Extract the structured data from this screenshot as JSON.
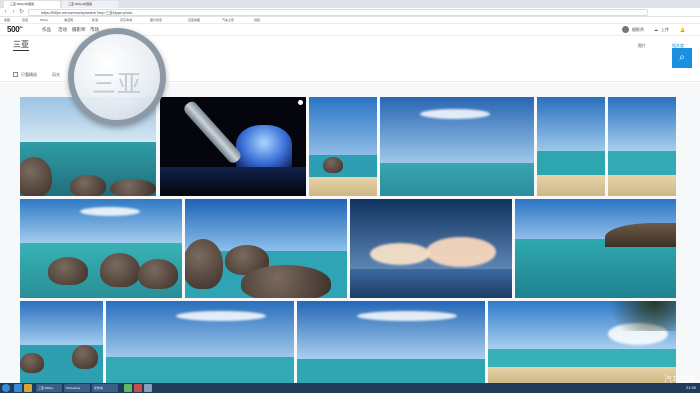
{
  "browser": {
    "tabs": [
      {
        "label": "三亚-500px中国版"
      },
      {
        "label": "三亚-500px中国版"
      }
    ],
    "url": "https://500px.me/community/search?key=三亚&type=photo"
  },
  "bookmarks": [
    "收藏",
    "百度",
    "500px",
    "淘宝网",
    "新浪",
    "京东商城",
    "图片搜索",
    "百度地图",
    "汽车之家",
    "视频"
  ],
  "site": {
    "logo": "500",
    "logo_sup": "px",
    "nav": [
      "作品",
      "活动",
      "摄影师",
      "市场"
    ],
    "user_name": "摄影师",
    "upload": "上传"
  },
  "page": {
    "title": "三亚",
    "sort_tab": "图片",
    "sort_active": "相关度",
    "filter_checkbox": "只看精选",
    "filter_style": "风光"
  },
  "magnifier_text": "三亚",
  "taskbar": {
    "windows": [
      "三亚-500px",
      "Photoshop",
      "文件夹"
    ],
    "tray": "21:30"
  },
  "watermark": "汽车之家",
  "colors": {
    "accent": "#1a91e0",
    "taskbar": "#1e3b5a"
  },
  "icons": [
    "search-icon",
    "back-icon",
    "forward-icon",
    "reload-icon",
    "magnifier-icon",
    "upload-icon",
    "bell-icon",
    "windows-start-icon"
  ]
}
